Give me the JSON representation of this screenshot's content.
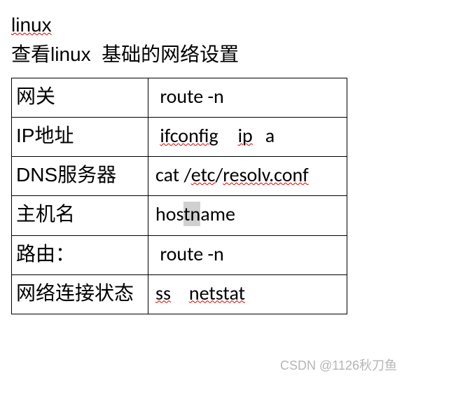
{
  "title_prefix": "linux",
  "subtitle_a": "查看",
  "subtitle_b": "linux",
  "subtitle_c": "基础的网络设置",
  "rows": [
    {
      "label": "网关",
      "v1": "route -n"
    },
    {
      "label": "IP地址",
      "v1": "ifconfig",
      "v2": "ip",
      "v3": "a"
    },
    {
      "label": "DNS服务器",
      "v1": "cat /",
      "v2": "etc",
      "v3": "/",
      "v4": "resolv.conf"
    },
    {
      "label": "主机名",
      "v1": "hos",
      "v2": "tn",
      "v3": "ame"
    },
    {
      "label": "路由：",
      "v1": "route -n"
    },
    {
      "label": "网络连接状态",
      "v1": "ss",
      "v2": "netstat"
    }
  ],
  "watermark": "CSDN @1126秋刀鱼"
}
